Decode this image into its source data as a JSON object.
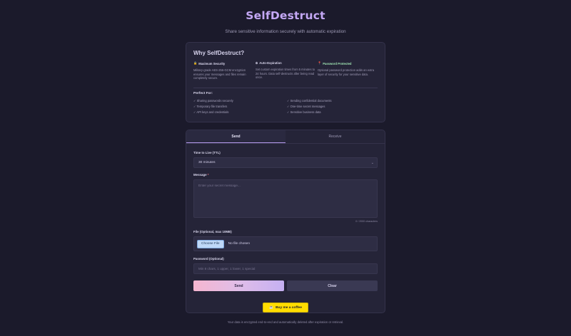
{
  "header": {
    "title": "SelfDestruct",
    "subtitle": "Share sensitive information securely with automatic expiration"
  },
  "info": {
    "title": "Why SelfDestruct?",
    "features": [
      {
        "icon": "lock-icon",
        "glyph": "🔒",
        "title": "Maximum Security",
        "desc": "Military-grade AES-256-GCM encryption ensures your messages and files remain completely secure."
      },
      {
        "icon": "timer-icon",
        "glyph": "⏲",
        "title": "Auto-Expiration",
        "desc": "Set custom expiration times from 5 minutes to 24 hours. Data self-destructs after being read once."
      },
      {
        "icon": "pin-icon",
        "glyph": "📍",
        "title": "Password Protected",
        "desc": "Optional password protection adds an extra layer of security for your sensitive data."
      }
    ],
    "perfect_title": "Perfect For:",
    "perfect_items": [
      "✓ Sharing passwords securely",
      "✓ Sending confidential documents",
      "✓ Temporary file transfers",
      "✓ One-time secret messages",
      "✓ API keys and credentials",
      "✓ Sensitive business data"
    ]
  },
  "tabs": {
    "send": "Send",
    "receive": "Receive"
  },
  "form": {
    "ttl_label": "Time to Live (TTL)",
    "ttl_value": "30 minutes",
    "message_label": "Message",
    "message_required": "*",
    "message_placeholder": "Enter your secret message...",
    "char_count": "0 / 2000 characters",
    "file_label": "File (Optional, max 10MB)",
    "file_button": "Choose File",
    "file_status": "No file chosen",
    "password_label": "Password (Optional)",
    "password_placeholder": "Min 8 chars, 1 upper, 1 lower, 1 special",
    "send_button": "Send",
    "clear_button": "Clear"
  },
  "coffee": {
    "label": "Buy me a coffee",
    "icon": "coffee-icon",
    "glyph": "☕"
  },
  "footer": {
    "text": "Your data is encrypted end-to-end and automatically deleted after expiration or retrieval."
  },
  "colors": {
    "accent": "#c4a8f5",
    "background": "#1b1a2b",
    "card": "#252438",
    "coffee": "#ffdd00"
  }
}
